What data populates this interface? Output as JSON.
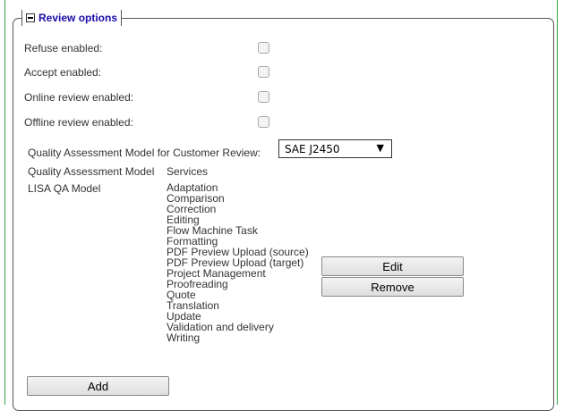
{
  "section": {
    "legend": "Review options"
  },
  "options": [
    {
      "label": "Refuse enabled:",
      "checked": false
    },
    {
      "label": "Accept enabled:",
      "checked": false
    },
    {
      "label": "Online review enabled:",
      "checked": false
    },
    {
      "label": "Offline review enabled:",
      "checked": false
    }
  ],
  "qa_select": {
    "label": "Quality Assessment Model for Customer Review:",
    "value": "SAE J2450"
  },
  "table": {
    "headers": [
      "Quality Assessment Model",
      "Services"
    ],
    "rows": [
      {
        "model": "LISA QA Model",
        "services": [
          "Adaptation",
          "Comparison",
          "Correction",
          "Editing",
          "Flow Machine Task",
          "Formatting",
          "PDF Preview Upload (source)",
          "PDF Preview Upload (target)",
          "Project Management",
          "Proofreading",
          "Quote",
          "Translation",
          "Update",
          "Validation and delivery",
          "Writing"
        ]
      }
    ]
  },
  "buttons": {
    "edit": "Edit",
    "remove": "Remove",
    "add": "Add"
  },
  "colors": {
    "frame": "#2ea64a",
    "legend_text": "#1a0dab"
  }
}
